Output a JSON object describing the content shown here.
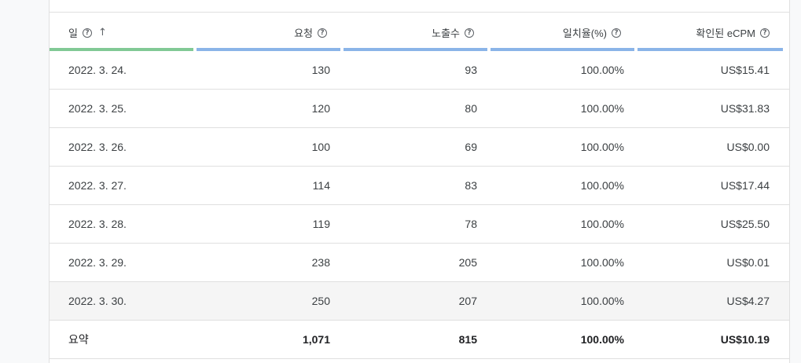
{
  "table": {
    "columns": [
      {
        "label": "일",
        "help": "?",
        "sort": "↑"
      },
      {
        "label": "요청",
        "help": "?"
      },
      {
        "label": "노출수",
        "help": "?"
      },
      {
        "label": "일치율(%)",
        "help": "?"
      },
      {
        "label": "확인된 eCPM",
        "help": "?"
      }
    ],
    "rows": [
      [
        "2022. 3. 24.",
        "130",
        "93",
        "100.00%",
        "US$15.41"
      ],
      [
        "2022. 3. 25.",
        "120",
        "80",
        "100.00%",
        "US$31.83"
      ],
      [
        "2022. 3. 26.",
        "100",
        "69",
        "100.00%",
        "US$0.00"
      ],
      [
        "2022. 3. 27.",
        "114",
        "83",
        "100.00%",
        "US$17.44"
      ],
      [
        "2022. 3. 28.",
        "119",
        "78",
        "100.00%",
        "US$25.50"
      ],
      [
        "2022. 3. 29.",
        "238",
        "205",
        "100.00%",
        "US$0.01"
      ],
      [
        "2022. 3. 30.",
        "250",
        "207",
        "100.00%",
        "US$4.27"
      ]
    ],
    "summary": [
      "요약",
      "1,071",
      "815",
      "100.00%",
      "US$10.19"
    ]
  },
  "colors": {
    "sorted_column_bar": "#81c995",
    "column_bar": "#8ab4e8",
    "hover_row": "#f5f5f5"
  },
  "icons": {
    "help": "help-circle-icon",
    "sort": "arrow-up-icon"
  }
}
